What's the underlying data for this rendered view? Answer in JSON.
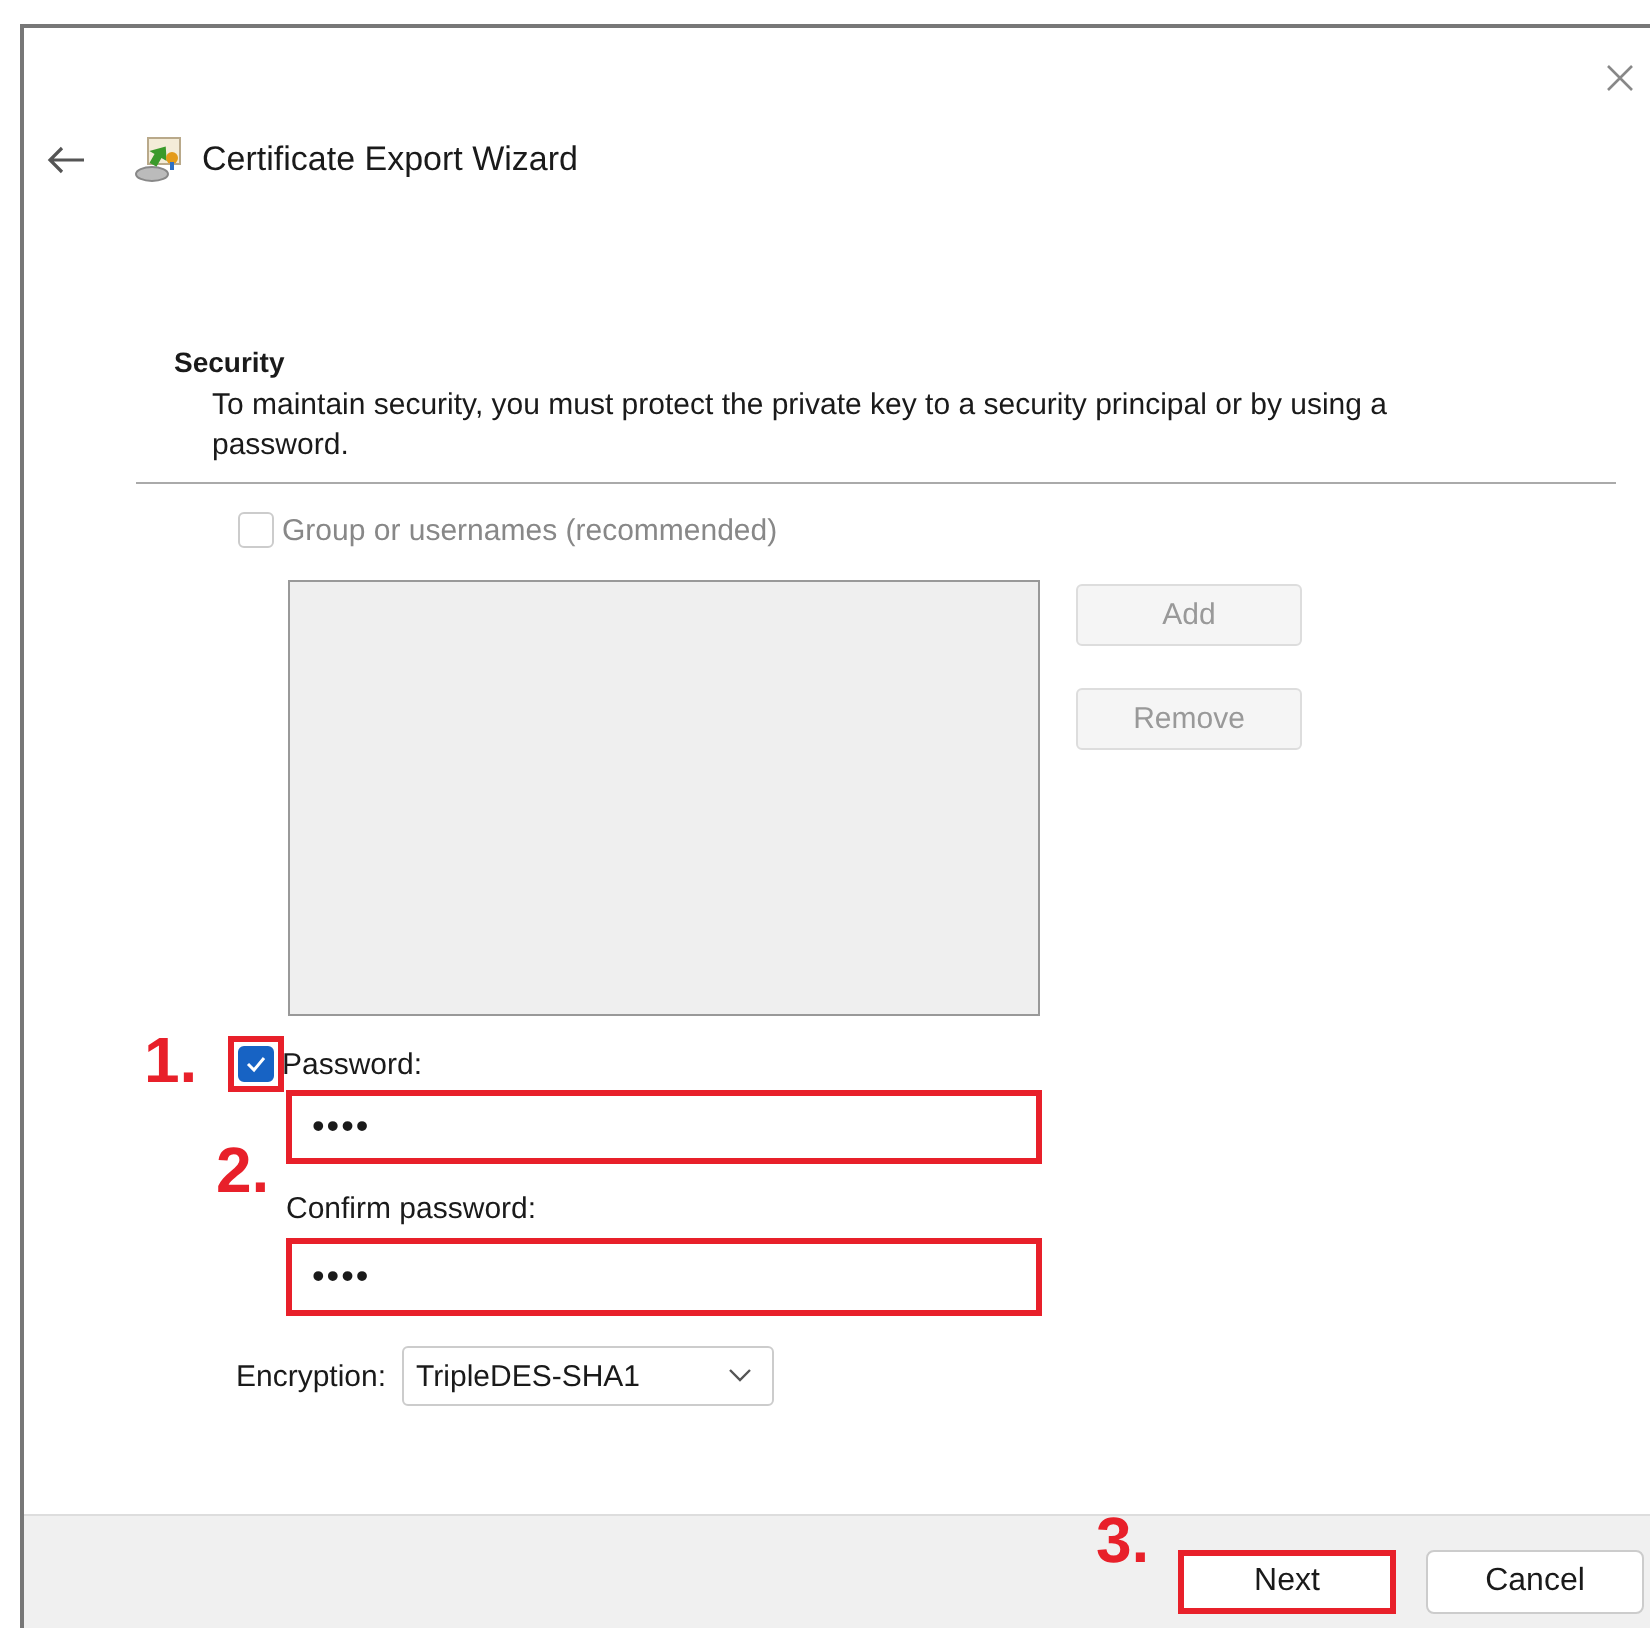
{
  "window": {
    "title": "Certificate Export Wizard"
  },
  "section": {
    "heading": "Security",
    "description": "To maintain security, you must protect the private key to a security principal or by using a password."
  },
  "group_option": {
    "label": "Group or usernames (recommended)",
    "checked": false,
    "disabled": true
  },
  "side_buttons": [
    {
      "label": "Add",
      "disabled": true
    },
    {
      "label": "Remove",
      "disabled": true
    }
  ],
  "password_option": {
    "label": "Password:",
    "checked": true,
    "highlighted": true
  },
  "password_field": {
    "value": "••••",
    "highlighted": true
  },
  "confirm_label": "Confirm password:",
  "confirm_field": {
    "value": "••••",
    "highlighted": true
  },
  "encryption": {
    "label": "Encryption:",
    "value": "TripleDES-SHA1"
  },
  "buttons": [
    {
      "label": "Next",
      "highlighted": true
    },
    {
      "label": "Cancel",
      "highlighted": false
    }
  ],
  "annotations": [
    {
      "label": "1."
    },
    {
      "label": "2."
    },
    {
      "label": "3."
    }
  ]
}
